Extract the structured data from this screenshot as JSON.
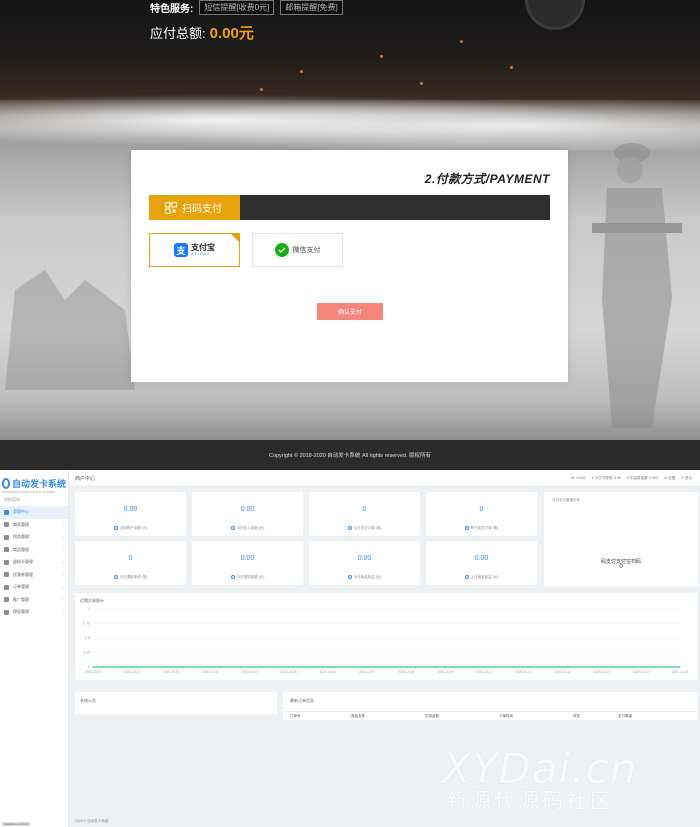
{
  "order": {
    "service_label": "特色服务:",
    "service_options": [
      "短信提醒[收费0元]",
      "邮箱提醒[免费]"
    ],
    "total_label": "应付总额:",
    "total_value": "0.00元"
  },
  "payment": {
    "heading": "2.付款方式/PAYMENT",
    "tab_label": "扫码支付",
    "alipay_cn": "支付宝",
    "alipay_en": "ALIPAY",
    "wechat_label": "微信支付",
    "confirm_label": "确认支付"
  },
  "footer": {
    "copyright": "Copyright © 2018-2020 自动发卡系统 All rights reserved. 版权所有"
  },
  "admin": {
    "logo": "自动发卡系统",
    "logo_sub": "AUTOMATIC CARD ISSUING SYSTEM",
    "nav_section": "导航菜单",
    "nav_items": [
      {
        "label": "管理中心",
        "active": true
      },
      {
        "label": "商家管理"
      },
      {
        "label": "财务管理"
      },
      {
        "label": "商品管理"
      },
      {
        "label": "虚拟卡管理"
      },
      {
        "label": "优惠券管理"
      },
      {
        "label": "订单管理"
      },
      {
        "label": "推广管理"
      },
      {
        "label": "提现管理"
      }
    ],
    "breadcrumb": "商户中心",
    "top_info": [
      "ID: 10001",
      "¥ 今日可提现: 0.00",
      "¥ 未结算金额: 0.000",
      "设置",
      "退出"
    ],
    "stats": [
      {
        "value": "0.00",
        "label": "当前账户余额 (元)"
      },
      {
        "value": "0.00",
        "label": "今日收入金额 (元)"
      },
      {
        "value": "0",
        "label": "今日成交订单 (笔)"
      },
      {
        "value": "0",
        "label": "昨日成交订单 (笔)"
      },
      {
        "value": "0",
        "label": "今日退款申请 (笔)"
      },
      {
        "value": "0.00",
        "label": "今日提现金额 (元)"
      },
      {
        "value": "0.00",
        "label": "今日佣金收益 (元)"
      },
      {
        "value": "0.00",
        "label": "上月佣金收益 (元)"
      }
    ],
    "today_title": "今日支付渠道分布",
    "today_text": "码支付支付宝扫码",
    "today_value": "0",
    "notice_title": "系统公告",
    "orders_title": "最新订单信息",
    "orders_columns": [
      "订单号",
      "商品名称",
      "交易金额",
      "下单时间",
      "状态",
      "支付渠道"
    ],
    "footer": "2020 © 自动发卡系统."
  },
  "chart_data": {
    "type": "line",
    "title": "近期交易统计",
    "x": [
      "2020-10-07",
      "2020-10-01",
      "2020-10-02",
      "2020-10-03",
      "2020-10-04",
      "2020-10-05",
      "2020-10-06",
      "2020-10-07",
      "2020-10-08",
      "2020-10-09",
      "2020-10-10",
      "2020-10-11",
      "2020-10-12",
      "2020-10-13",
      "2020-10-14",
      "2020-10-15"
    ],
    "y_ticks": [
      "1",
      "0.75",
      "0.5",
      "0.25",
      "0"
    ],
    "values": [
      0,
      0,
      0,
      0,
      0,
      0,
      0,
      0,
      0,
      0,
      0,
      0,
      0,
      0,
      0,
      0
    ],
    "ylim": [
      0,
      1
    ],
    "color": "#2ecc71"
  },
  "watermark": {
    "line1": "XYDai.cn",
    "line2": "新源代源码社区"
  },
  "status_bar": "gkgk8com.cn/html"
}
